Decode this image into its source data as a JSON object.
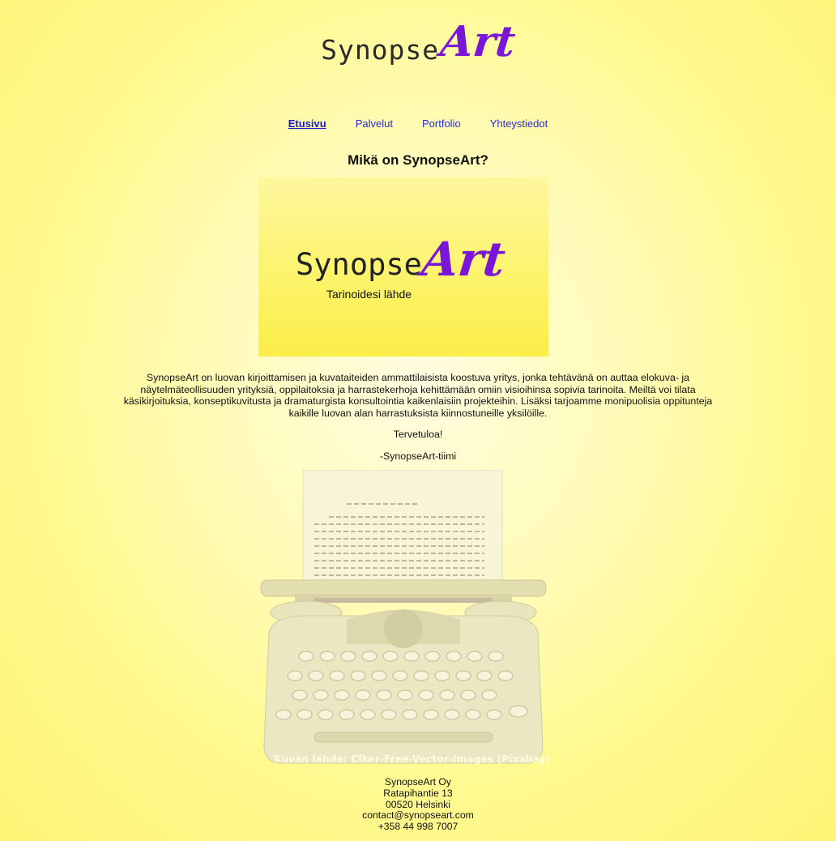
{
  "logo": {
    "text_main": "Synopse",
    "text_accent": "Art"
  },
  "nav": [
    {
      "label": "Etusivu",
      "active": true
    },
    {
      "label": "Palvelut",
      "active": false
    },
    {
      "label": "Portfolio",
      "active": false
    },
    {
      "label": "Yhteystiedot",
      "active": false
    }
  ],
  "main": {
    "heading": "Mikä on SynopseArt?",
    "banner": {
      "text_main": "Synopse",
      "text_accent": "Art",
      "tagline": "Tarinoidesi lähde"
    },
    "intro": "SynopseArt on luovan kirjoittamisen ja kuvataiteiden ammattilaisista koostuva yritys, jonka tehtävänä on auttaa elokuva- ja näytelmäteollisuuden yrityksiä, oppilaitoksia ja harrastekerhoja kehittämään omiin visioihinsa sopivia tarinoita. Meiltä voi tilata käsikirjoituksia, konseptikuvitusta ja dramaturgista konsultointia kaikenlaisiin projekteihin. Lisäksi tarjoamme monipuolisia oppitunteja kaikille luovan alan harrastuksista kiinnostuneille yksilöille.",
    "greeting": "Tervetuloa!",
    "signature": "-SynopseArt-tiimi",
    "image_credit": "Kuvan lähde: Clker-Free-Vector-Images (Pixabay)"
  },
  "footer": {
    "company": "SynopseArt Oy",
    "street": "Ratapihantie 13",
    "city": "00520 Helsinki",
    "email": "contact@synopseart.com",
    "phone": "+358 44 998 7007"
  },
  "colors": {
    "accent": "#7a17d6",
    "link": "#2a2ad6",
    "background": "#fffbb8"
  }
}
